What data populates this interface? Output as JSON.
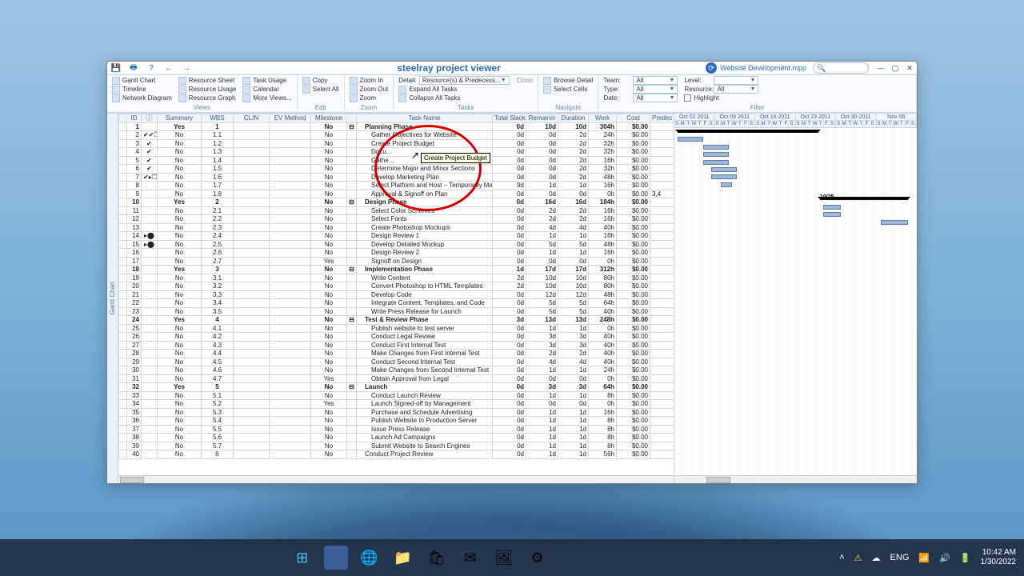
{
  "app": {
    "title": "steelray project viewer",
    "document": "Website Development.mpp"
  },
  "ribbon": {
    "views": {
      "label": "Views",
      "gantt": "Gantt Chart",
      "timeline": "Timeline",
      "network": "Network Diagram",
      "resourceSheet": "Resource Sheet",
      "resourceUsage": "Resource Usage",
      "resourceGraph": "Resource Graph",
      "taskUsage": "Task Usage",
      "calendar": "Calendar",
      "moreViews": "More Views..."
    },
    "edit": {
      "label": "Edit",
      "copy": "Copy",
      "selectAll": "Select All"
    },
    "zoom": {
      "label": "Zoom",
      "in": "Zoom In",
      "out": "Zoom Out",
      "zoom": "Zoom"
    },
    "tasks": {
      "label": "Tasks",
      "detail": "Detail:",
      "value": "Resource(s) & Predecess...",
      "close": "Close",
      "expand": "Expand All Tasks",
      "collapse": "Collapse All Tasks"
    },
    "navigate": {
      "label": "Navigate",
      "browse": "Browse Detail",
      "select": "Select Cells"
    },
    "filter": {
      "label": "Filter",
      "team": "Team:",
      "teamV": "All",
      "type": "Type:",
      "typeV": "All",
      "date": "Date:",
      "dateV": "All",
      "level": "Level:",
      "levelV": "",
      "resource": "Resource:",
      "resourceV": "All",
      "highlight": "Highlight"
    }
  },
  "sidebar": {
    "label": "Gantt Chart"
  },
  "columns": [
    "",
    "ID",
    "ⓘ",
    "Summary",
    "WBS",
    "CLIN",
    "EV Method",
    "Milestone",
    "",
    "Task Name",
    "Total Slack",
    "Remainin",
    "Duration",
    "Work",
    "Cost",
    "Predec"
  ],
  "rows": [
    {
      "id": "1",
      "ind": "",
      "sum": "Yes",
      "wbs": "1",
      "mil": "No",
      "lvl": 0,
      "name": "Planning Phase",
      "slack": "0d",
      "rem": "10d",
      "dur": "10d",
      "work": "304h",
      "cost": "$0.00",
      "bold": true
    },
    {
      "id": "2",
      "ind": "✔✔❐",
      "sum": "No",
      "wbs": "1.1",
      "mil": "No",
      "lvl": 1,
      "name": "Gather Objectives for Website",
      "slack": "0d",
      "rem": "0d",
      "dur": "2d",
      "work": "24h",
      "cost": "$0.00"
    },
    {
      "id": "3",
      "ind": "✔",
      "sum": "No",
      "wbs": "1.2",
      "mil": "No",
      "lvl": 1,
      "name": "Create Project Budget",
      "slack": "0d",
      "rem": "0d",
      "dur": "2d",
      "work": "32h",
      "cost": "$0.00"
    },
    {
      "id": "4",
      "ind": "✔",
      "sum": "No",
      "wbs": "1.3",
      "mil": "No",
      "lvl": 1,
      "name": "Docu...",
      "slack": "0d",
      "rem": "0d",
      "dur": "2d",
      "work": "32h",
      "cost": "$0.00"
    },
    {
      "id": "5",
      "ind": "✔",
      "sum": "No",
      "wbs": "1.4",
      "mil": "No",
      "lvl": 1,
      "name": "Gathe...",
      "slack": "0d",
      "rem": "0d",
      "dur": "2d",
      "work": "16h",
      "cost": "$0.00"
    },
    {
      "id": "6",
      "ind": "✔",
      "sum": "No",
      "wbs": "1.5",
      "mil": "No",
      "lvl": 1,
      "name": "Determine Major and Minor Sections",
      "slack": "0d",
      "rem": "0d",
      "dur": "2d",
      "work": "32h",
      "cost": "$0.00"
    },
    {
      "id": "7",
      "ind": "✔▸❐",
      "sum": "No",
      "wbs": "1.6",
      "mil": "No",
      "lvl": 1,
      "name": "Develop Marketing Plan",
      "slack": "0d",
      "rem": "0d",
      "dur": "2d",
      "work": "48h",
      "cost": "$0.00"
    },
    {
      "id": "8",
      "ind": "",
      "sum": "No",
      "wbs": "1.7",
      "mil": "No",
      "lvl": 1,
      "name": "Select Platform and Host – Temporarily Make this task have",
      "slack": "9d",
      "rem": "1d",
      "dur": "1d",
      "work": "16h",
      "cost": "$0.00"
    },
    {
      "id": "9",
      "ind": "",
      "sum": "No",
      "wbs": "1.8",
      "mil": "No",
      "lvl": 1,
      "name": "Approval & Signoff on Plan",
      "slack": "0d",
      "rem": "0d",
      "dur": "0d",
      "work": "0h",
      "cost": "$0.00",
      "pred": "3,4"
    },
    {
      "id": "10",
      "ind": "",
      "sum": "Yes",
      "wbs": "2",
      "mil": "No",
      "lvl": 0,
      "name": "Design Phase",
      "slack": "0d",
      "rem": "16d",
      "dur": "16d",
      "work": "184h",
      "cost": "$0.00",
      "bold": true
    },
    {
      "id": "11",
      "ind": "",
      "sum": "No",
      "wbs": "2.1",
      "mil": "No",
      "lvl": 1,
      "name": "Select Color Schemes",
      "slack": "0d",
      "rem": "2d",
      "dur": "2d",
      "work": "16h",
      "cost": "$0.00"
    },
    {
      "id": "12",
      "ind": "",
      "sum": "No",
      "wbs": "2.2",
      "mil": "No",
      "lvl": 1,
      "name": "Select Fonts",
      "slack": "0d",
      "rem": "2d",
      "dur": "2d",
      "work": "16h",
      "cost": "$0.00"
    },
    {
      "id": "13",
      "ind": "",
      "sum": "No",
      "wbs": "2.3",
      "mil": "No",
      "lvl": 1,
      "name": "Create Photoshop Mockups",
      "slack": "0d",
      "rem": "4d",
      "dur": "4d",
      "work": "40h",
      "cost": "$0.00"
    },
    {
      "id": "14",
      "ind": "▸⬤",
      "sum": "No",
      "wbs": "2.4",
      "mil": "No",
      "lvl": 1,
      "name": "Design Review 1",
      "slack": "0d",
      "rem": "1d",
      "dur": "1d",
      "work": "16h",
      "cost": "$0.00"
    },
    {
      "id": "15",
      "ind": "▸⬤",
      "sum": "No",
      "wbs": "2.5",
      "mil": "No",
      "lvl": 1,
      "name": "Develop Detailed Mockup",
      "slack": "0d",
      "rem": "5d",
      "dur": "5d",
      "work": "48h",
      "cost": "$0.00"
    },
    {
      "id": "16",
      "ind": "",
      "sum": "No",
      "wbs": "2.6",
      "mil": "No",
      "lvl": 1,
      "name": "Design Review 2",
      "slack": "0d",
      "rem": "1d",
      "dur": "1d",
      "work": "16h",
      "cost": "$0.00"
    },
    {
      "id": "17",
      "ind": "",
      "sum": "No",
      "wbs": "2.7",
      "mil": "Yes",
      "lvl": 1,
      "name": "Signoff on Design",
      "slack": "0d",
      "rem": "0d",
      "dur": "0d",
      "work": "0h",
      "cost": "$0.00"
    },
    {
      "id": "18",
      "ind": "",
      "sum": "Yes",
      "wbs": "3",
      "mil": "No",
      "lvl": 0,
      "name": "Implementation Phase",
      "slack": "1d",
      "rem": "17d",
      "dur": "17d",
      "work": "312h",
      "cost": "$0.00",
      "bold": true
    },
    {
      "id": "19",
      "ind": "",
      "sum": "No",
      "wbs": "3.1",
      "mil": "No",
      "lvl": 1,
      "name": "Write Content",
      "slack": "2d",
      "rem": "10d",
      "dur": "10d",
      "work": "80h",
      "cost": "$0.00"
    },
    {
      "id": "20",
      "ind": "",
      "sum": "No",
      "wbs": "3.2",
      "mil": "No",
      "lvl": 1,
      "name": "Convert Photoshop to HTML Templates",
      "slack": "2d",
      "rem": "10d",
      "dur": "10d",
      "work": "80h",
      "cost": "$0.00"
    },
    {
      "id": "21",
      "ind": "",
      "sum": "No",
      "wbs": "3.3",
      "mil": "No",
      "lvl": 1,
      "name": "Develop Code",
      "slack": "0d",
      "rem": "12d",
      "dur": "12d",
      "work": "48h",
      "cost": "$0.00"
    },
    {
      "id": "22",
      "ind": "",
      "sum": "No",
      "wbs": "3.4",
      "mil": "No",
      "lvl": 1,
      "name": "Integrate Content, Templates, and Code",
      "slack": "0d",
      "rem": "5d",
      "dur": "5d",
      "work": "64h",
      "cost": "$0.00"
    },
    {
      "id": "23",
      "ind": "",
      "sum": "No",
      "wbs": "3.5",
      "mil": "No",
      "lvl": 1,
      "name": "Write Press Release for Launch",
      "slack": "0d",
      "rem": "5d",
      "dur": "5d",
      "work": "40h",
      "cost": "$0.00"
    },
    {
      "id": "24",
      "ind": "",
      "sum": "Yes",
      "wbs": "4",
      "mil": "No",
      "lvl": 0,
      "name": "Test & Review Phase",
      "slack": "3d",
      "rem": "13d",
      "dur": "13d",
      "work": "248h",
      "cost": "$0.00",
      "bold": true
    },
    {
      "id": "25",
      "ind": "",
      "sum": "No",
      "wbs": "4.1",
      "mil": "No",
      "lvl": 1,
      "name": "Publish website to test server",
      "slack": "0d",
      "rem": "1d",
      "dur": "1d",
      "work": "0h",
      "cost": "$0.00"
    },
    {
      "id": "26",
      "ind": "",
      "sum": "No",
      "wbs": "4.2",
      "mil": "No",
      "lvl": 1,
      "name": "Conduct Legal Review",
      "slack": "0d",
      "rem": "3d",
      "dur": "3d",
      "work": "40h",
      "cost": "$0.00"
    },
    {
      "id": "27",
      "ind": "",
      "sum": "No",
      "wbs": "4.3",
      "mil": "No",
      "lvl": 1,
      "name": "Conduct First Internal Test",
      "slack": "0d",
      "rem": "3d",
      "dur": "3d",
      "work": "40h",
      "cost": "$0.00"
    },
    {
      "id": "28",
      "ind": "",
      "sum": "No",
      "wbs": "4.4",
      "mil": "No",
      "lvl": 1,
      "name": "Make Changes from First Internal Test",
      "slack": "0d",
      "rem": "2d",
      "dur": "2d",
      "work": "40h",
      "cost": "$0.00"
    },
    {
      "id": "29",
      "ind": "",
      "sum": "No",
      "wbs": "4.5",
      "mil": "No",
      "lvl": 1,
      "name": "Conduct Second Internal Test",
      "slack": "0d",
      "rem": "4d",
      "dur": "4d",
      "work": "40h",
      "cost": "$0.00"
    },
    {
      "id": "30",
      "ind": "",
      "sum": "No",
      "wbs": "4.6",
      "mil": "No",
      "lvl": 1,
      "name": "Make Changes from Second Internal Test",
      "slack": "0d",
      "rem": "1d",
      "dur": "1d",
      "work": "24h",
      "cost": "$0.00"
    },
    {
      "id": "31",
      "ind": "",
      "sum": "No",
      "wbs": "4.7",
      "mil": "Yes",
      "lvl": 1,
      "name": "Obtain Approval from Legal",
      "slack": "0d",
      "rem": "0d",
      "dur": "0d",
      "work": "0h",
      "cost": "$0.00"
    },
    {
      "id": "32",
      "ind": "",
      "sum": "Yes",
      "wbs": "5",
      "mil": "No",
      "lvl": 0,
      "name": "Launch",
      "slack": "0d",
      "rem": "3d",
      "dur": "3d",
      "work": "64h",
      "cost": "$0.00",
      "bold": true
    },
    {
      "id": "33",
      "ind": "",
      "sum": "No",
      "wbs": "5.1",
      "mil": "No",
      "lvl": 1,
      "name": "Conduct Launch Review",
      "slack": "0d",
      "rem": "1d",
      "dur": "1d",
      "work": "8h",
      "cost": "$0.00"
    },
    {
      "id": "34",
      "ind": "",
      "sum": "No",
      "wbs": "5.2",
      "mil": "Yes",
      "lvl": 1,
      "name": "Launch Signed-off by Management",
      "slack": "0d",
      "rem": "0d",
      "dur": "0d",
      "work": "0h",
      "cost": "$0.00"
    },
    {
      "id": "35",
      "ind": "",
      "sum": "No",
      "wbs": "5.3",
      "mil": "No",
      "lvl": 1,
      "name": "Purchase and Schedule Advertising",
      "slack": "0d",
      "rem": "1d",
      "dur": "1d",
      "work": "16h",
      "cost": "$0.00"
    },
    {
      "id": "36",
      "ind": "",
      "sum": "No",
      "wbs": "5.4",
      "mil": "No",
      "lvl": 1,
      "name": "Publish Website to Production Server",
      "slack": "0d",
      "rem": "1d",
      "dur": "1d",
      "work": "8h",
      "cost": "$0.00"
    },
    {
      "id": "37",
      "ind": "",
      "sum": "No",
      "wbs": "5.5",
      "mil": "No",
      "lvl": 1,
      "name": "Issue Press Release",
      "slack": "0d",
      "rem": "1d",
      "dur": "1d",
      "work": "8h",
      "cost": "$0.00"
    },
    {
      "id": "38",
      "ind": "",
      "sum": "No",
      "wbs": "5.6",
      "mil": "No",
      "lvl": 1,
      "name": "Launch Ad Campaigns",
      "slack": "0d",
      "rem": "1d",
      "dur": "1d",
      "work": "8h",
      "cost": "$0.00"
    },
    {
      "id": "39",
      "ind": "",
      "sum": "No",
      "wbs": "5.7",
      "mil": "No",
      "lvl": 1,
      "name": "Submit Website to Search Engines",
      "slack": "0d",
      "rem": "1d",
      "dur": "1d",
      "work": "8h",
      "cost": "$0.00"
    },
    {
      "id": "40",
      "ind": "",
      "sum": "No",
      "wbs": "6",
      "mil": "No",
      "lvl": 0,
      "name": "Conduct Project Review",
      "slack": "0d",
      "rem": "1d",
      "dur": "1d",
      "work": "56h",
      "cost": "$0.00"
    }
  ],
  "tooltip": "Create Project Budget",
  "gantt": {
    "weeks": [
      "Oct 02 2011",
      "Oct 09 2011",
      "Oct 16 2011",
      "Oct 23 2011",
      "Oct 30 2011",
      "Nov 06"
    ],
    "days": "SMTWTFS",
    "label": "10/25"
  },
  "taskbar": {
    "lang": "ENG",
    "time": "10:42 AM",
    "date": "1/30/2022"
  }
}
